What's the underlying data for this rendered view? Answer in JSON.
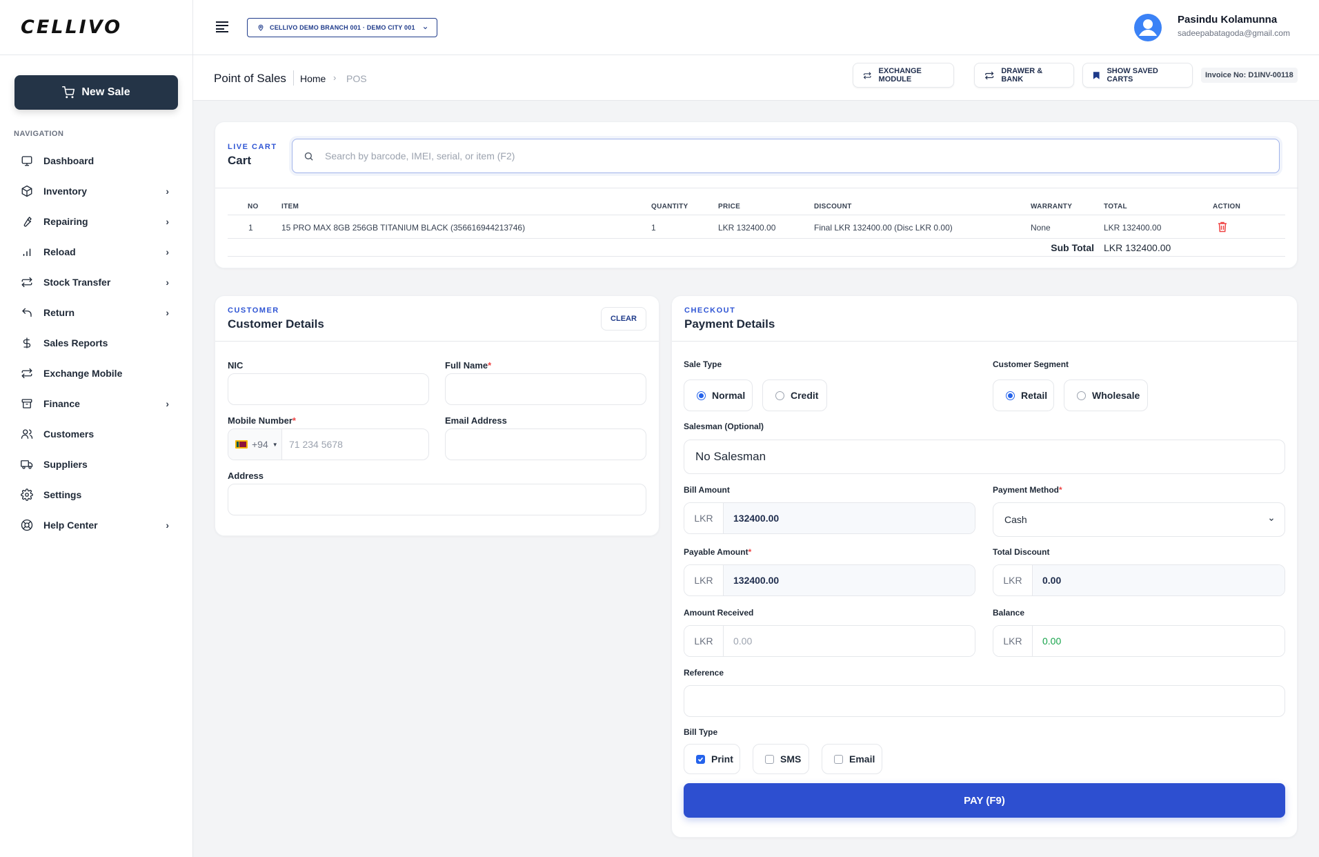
{
  "app": {
    "logo": "CELLIVO",
    "new_sale": "New Sale"
  },
  "sidebar": {
    "nav_title": "NAVIGATION",
    "items": [
      {
        "label": "Dashboard",
        "icon": "monitor-icon",
        "has_submenu": false
      },
      {
        "label": "Inventory",
        "icon": "box-icon",
        "has_submenu": true
      },
      {
        "label": "Repairing",
        "icon": "wrench-icon",
        "has_submenu": true
      },
      {
        "label": "Reload",
        "icon": "signal-bars-icon",
        "has_submenu": true
      },
      {
        "label": "Stock Transfer",
        "icon": "transfer-icon",
        "has_submenu": true
      },
      {
        "label": "Return",
        "icon": "return-arrow-icon",
        "has_submenu": true
      },
      {
        "label": "Sales Reports",
        "icon": "dollar-icon",
        "has_submenu": false
      },
      {
        "label": "Exchange Mobile",
        "icon": "exchange-icon",
        "has_submenu": false
      },
      {
        "label": "Finance",
        "icon": "archive-icon",
        "has_submenu": true
      },
      {
        "label": "Customers",
        "icon": "users-icon",
        "has_submenu": false
      },
      {
        "label": "Suppliers",
        "icon": "truck-icon",
        "has_submenu": false
      },
      {
        "label": "Settings",
        "icon": "gear-icon",
        "has_submenu": false
      },
      {
        "label": "Help Center",
        "icon": "lifebuoy-icon",
        "has_submenu": true
      }
    ]
  },
  "topbar": {
    "branch": "CELLIVO DEMO BRANCH 001 · DEMO CITY 001",
    "user_name": "Pasindu Kolamunna",
    "user_email": "sadeepabatagoda@gmail.com"
  },
  "subheader": {
    "title": "Point of Sales",
    "crumb_home": "Home",
    "crumb_current": "POS",
    "exchange_module": "EXCHANGE MODULE",
    "drawer_bank": "DRAWER & BANK",
    "saved_carts": "SHOW SAVED CARTS",
    "invoice": "Invoice No: D1INV-00118"
  },
  "cart": {
    "eyebrow": "LIVE CART",
    "title": "Cart",
    "search_placeholder": "Search by barcode, IMEI, serial, or item (F2)",
    "columns": {
      "no": "NO",
      "item": "ITEM",
      "quantity": "QUANTITY",
      "price": "PRICE",
      "discount": "DISCOUNT",
      "warranty": "WARRANTY",
      "total": "TOTAL",
      "action": "ACTION"
    },
    "rows": [
      {
        "no": "1",
        "item": "15 PRO MAX 8GB 256GB TITANIUM BLACK (356616944213746)",
        "quantity": "1",
        "price": "LKR 132400.00",
        "discount": "Final LKR 132400.00 (Disc LKR 0.00)",
        "warranty": "None",
        "total": "LKR 132400.00"
      }
    ],
    "subtotal_label": "Sub Total",
    "subtotal_value": "LKR 132400.00"
  },
  "customer": {
    "eyebrow": "CUSTOMER",
    "title": "Customer Details",
    "clear": "CLEAR",
    "nic_label": "NIC",
    "full_name_label": "Full Name",
    "mobile_label": "Mobile Number",
    "country_code": "+94",
    "mobile_placeholder": "71 234 5678",
    "email_label": "Email Address",
    "address_label": "Address",
    "required_mark": "*"
  },
  "payment": {
    "eyebrow": "CHECKOUT",
    "title": "Payment Details",
    "sale_type_label": "Sale Type",
    "sale_type_normal": "Normal",
    "sale_type_credit": "Credit",
    "segment_label": "Customer Segment",
    "segment_retail": "Retail",
    "segment_wholesale": "Wholesale",
    "salesman_label": "Salesman (Optional)",
    "salesman_value": "No Salesman",
    "bill_amount_label": "Bill Amount",
    "currency": "LKR",
    "bill_amount": "132400.00",
    "payment_method_label": "Payment Method",
    "payment_method_value": "Cash",
    "payable_label": "Payable Amount",
    "payable_amount": "132400.00",
    "total_discount_label": "Total Discount",
    "total_discount": "0.00",
    "amount_received_label": "Amount Received",
    "amount_received_placeholder": "0.00",
    "balance_label": "Balance",
    "balance": "0.00",
    "reference_label": "Reference",
    "bill_type_label": "Bill Type",
    "bill_print": "Print",
    "bill_sms": "SMS",
    "bill_email": "Email",
    "pay_button": "PAY (F9)"
  },
  "colors": {
    "primary": "#2d4fd0",
    "sidebar_button": "#243447",
    "accent_text": "#2f55d4",
    "danger": "#ef4444",
    "success": "#16a34a"
  }
}
